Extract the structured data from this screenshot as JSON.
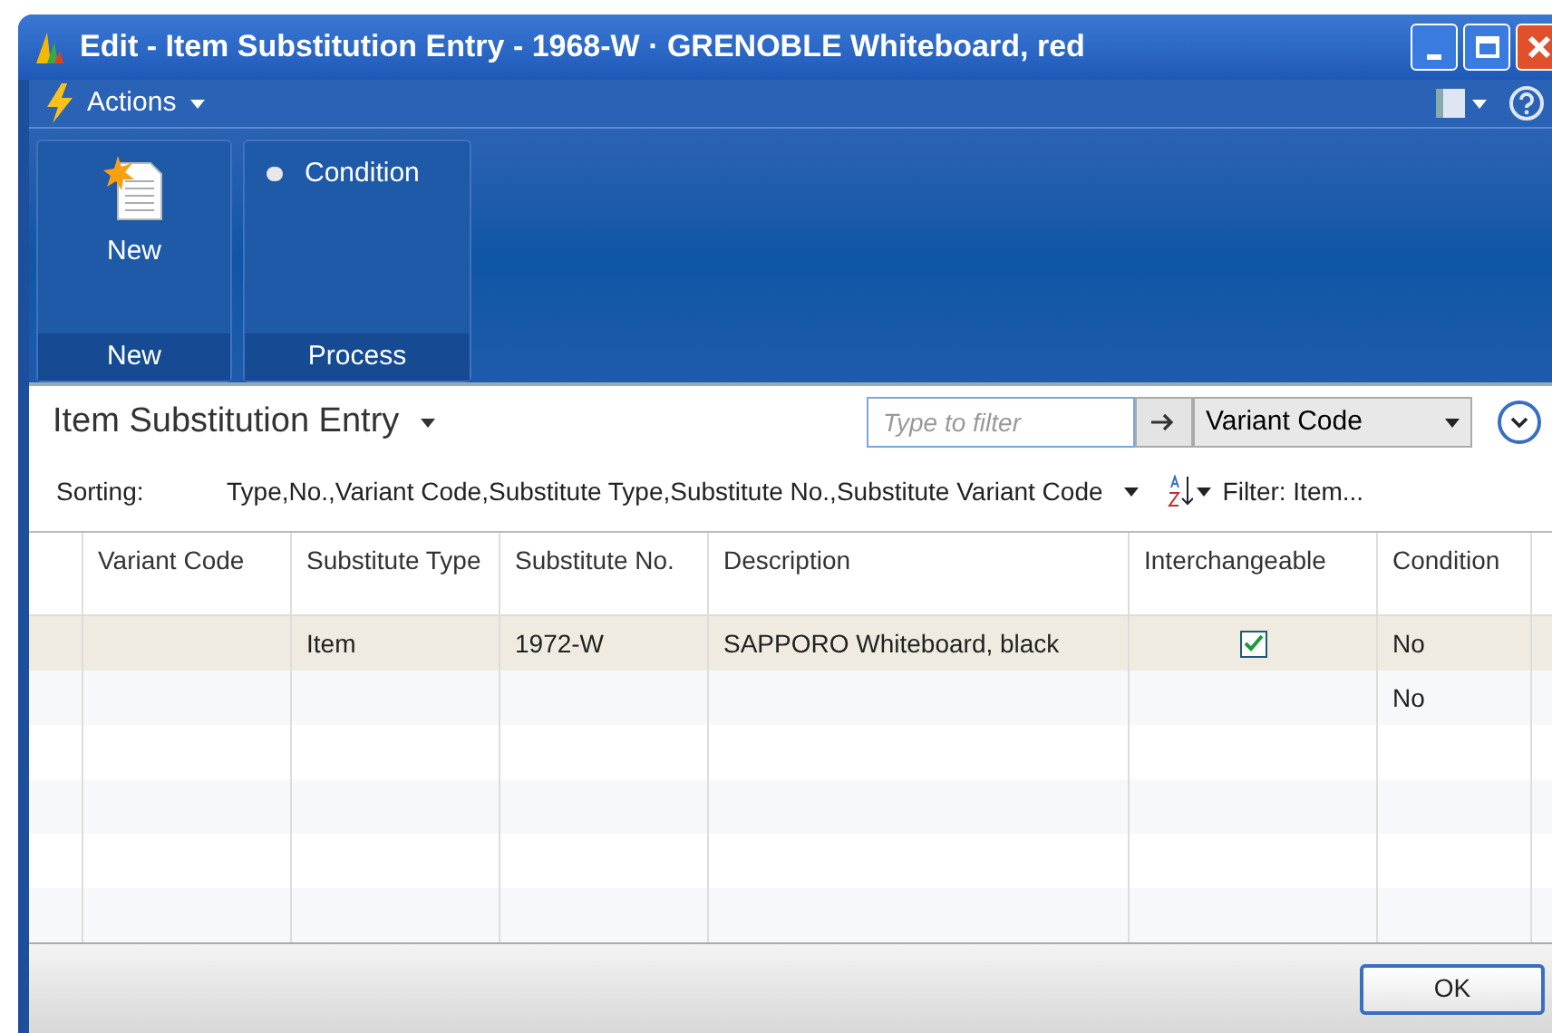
{
  "window": {
    "title": "Edit - Item Substitution Entry - 1968-W · GRENOBLE Whiteboard, red"
  },
  "actions_menu": {
    "label": "Actions"
  },
  "ribbon": {
    "groups": [
      {
        "label": "New",
        "items": [
          {
            "kind": "large",
            "label": "New"
          }
        ]
      },
      {
        "label": "Process",
        "items": [
          {
            "kind": "small",
            "label": "Condition"
          }
        ]
      }
    ]
  },
  "page": {
    "title": "Item Substitution Entry",
    "filter": {
      "placeholder": "Type to filter",
      "field": "Variant Code"
    },
    "sorting_label": "Sorting:",
    "sorting": "Type,No.,Variant Code,Substitute Type,Substitute No.,Substitute Variant Code",
    "filter_text": "Filter: Item..."
  },
  "table": {
    "columns": [
      "Variant Code",
      "Substitute Type",
      "Substitute No.",
      "Description",
      "Interchangeable",
      "Condition"
    ],
    "rows": [
      {
        "selected": true,
        "variant_code": "",
        "substitute_type": "Item",
        "substitute_no": "1972-W",
        "description": "SAPPORO Whiteboard, black",
        "interchangeable": true,
        "condition": "No"
      },
      {
        "selected": false,
        "condition": "No"
      }
    ]
  },
  "buttons": [
    "OK"
  ]
}
